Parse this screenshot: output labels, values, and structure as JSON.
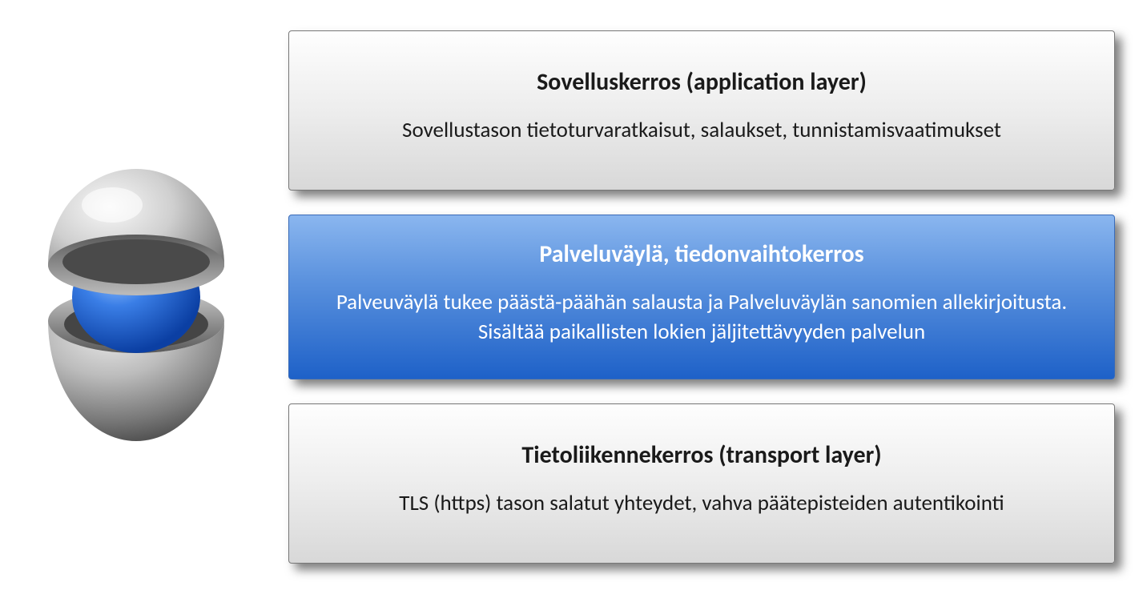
{
  "layers": [
    {
      "title": "Sovelluskerros (application layer)",
      "description": "Sovellustason tietoturvaratkaisut, salaukset, tunnistamisvaatimukset",
      "variant": "gray"
    },
    {
      "title": "Palveluväylä, tiedonvaihtokerros",
      "description": "Palveuväylä tukee päästä-päähän salausta ja Palveluväylän sanomien allekirjoitusta. Sisältää paikallisten lokien jäljitettävyyden palvelun",
      "variant": "blue"
    },
    {
      "title": "Tietoliikennekerros (transport layer)",
      "description": "TLS (https) tason salatut yhteydet, vahva päätepisteiden autentikointi",
      "variant": "gray"
    }
  ],
  "graphic": {
    "name": "layered-sphere-icon"
  }
}
